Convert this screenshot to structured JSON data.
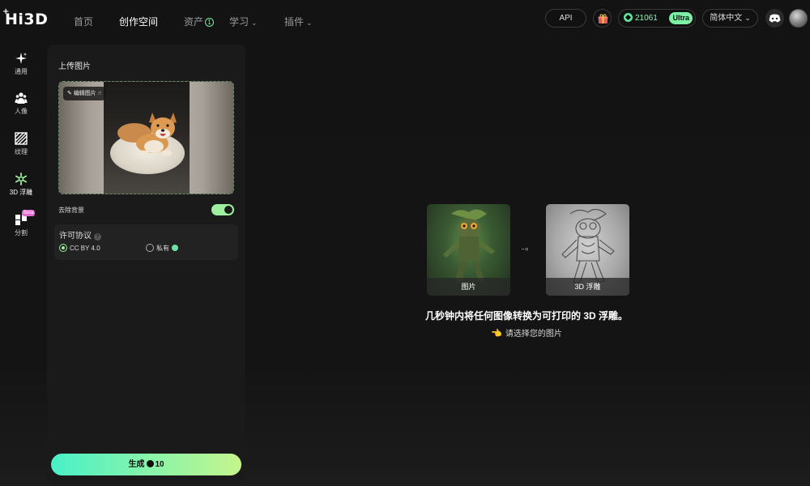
{
  "header": {
    "logo": "Hi3D",
    "logo_plus": "+",
    "nav": [
      {
        "label": "首页",
        "active": false
      },
      {
        "label": "创作空间",
        "active": true
      },
      {
        "label": "资产",
        "active": false,
        "badge": "1"
      },
      {
        "label": "学习",
        "active": false,
        "dropdown": true
      },
      {
        "label": "插件",
        "active": false,
        "dropdown": true
      }
    ],
    "api_label": "API",
    "credits": "21061",
    "plan": "Ultra",
    "language": "简体中文",
    "icons": [
      "gift-icon",
      "coin-icon",
      "discord-icon",
      "avatar"
    ]
  },
  "sidebar": {
    "items": [
      {
        "label": "通用",
        "icon": "sparkle-icon"
      },
      {
        "label": "人像",
        "icon": "people-icon"
      },
      {
        "label": "纹理",
        "icon": "texture-icon"
      },
      {
        "label": "3D 浮雕",
        "icon": "relief-icon",
        "active": true
      },
      {
        "label": "分割",
        "icon": "split-icon",
        "badge": "Beta"
      }
    ]
  },
  "panel": {
    "title": "上传图片",
    "edit_chip": "编辑图片",
    "remove_bg_label": "去除背景",
    "remove_bg_on": true,
    "license": {
      "title": "许可协议",
      "help": "?",
      "options": [
        {
          "label": "CC BY 4.0",
          "selected": true
        },
        {
          "label": "私有",
          "selected": false
        }
      ]
    },
    "generate": {
      "label": "生成",
      "cost": "10"
    }
  },
  "main": {
    "example_source_label": "图片",
    "example_result_label": "3D 浮雕",
    "arrow": "···›",
    "headline": "几秒钟内将任何图像转换为可打印的 3D 浮雕。",
    "hint": "请选择您的图片",
    "hint_icon": "👈"
  },
  "colors": {
    "accent_green": "#9ef0a0",
    "button_gradient": [
      "#49f0c8",
      "#8cf4a8",
      "#c6f58c"
    ],
    "beta_badge": "#e46bd1",
    "background": "#131313",
    "panel": "#1a1a1a"
  }
}
